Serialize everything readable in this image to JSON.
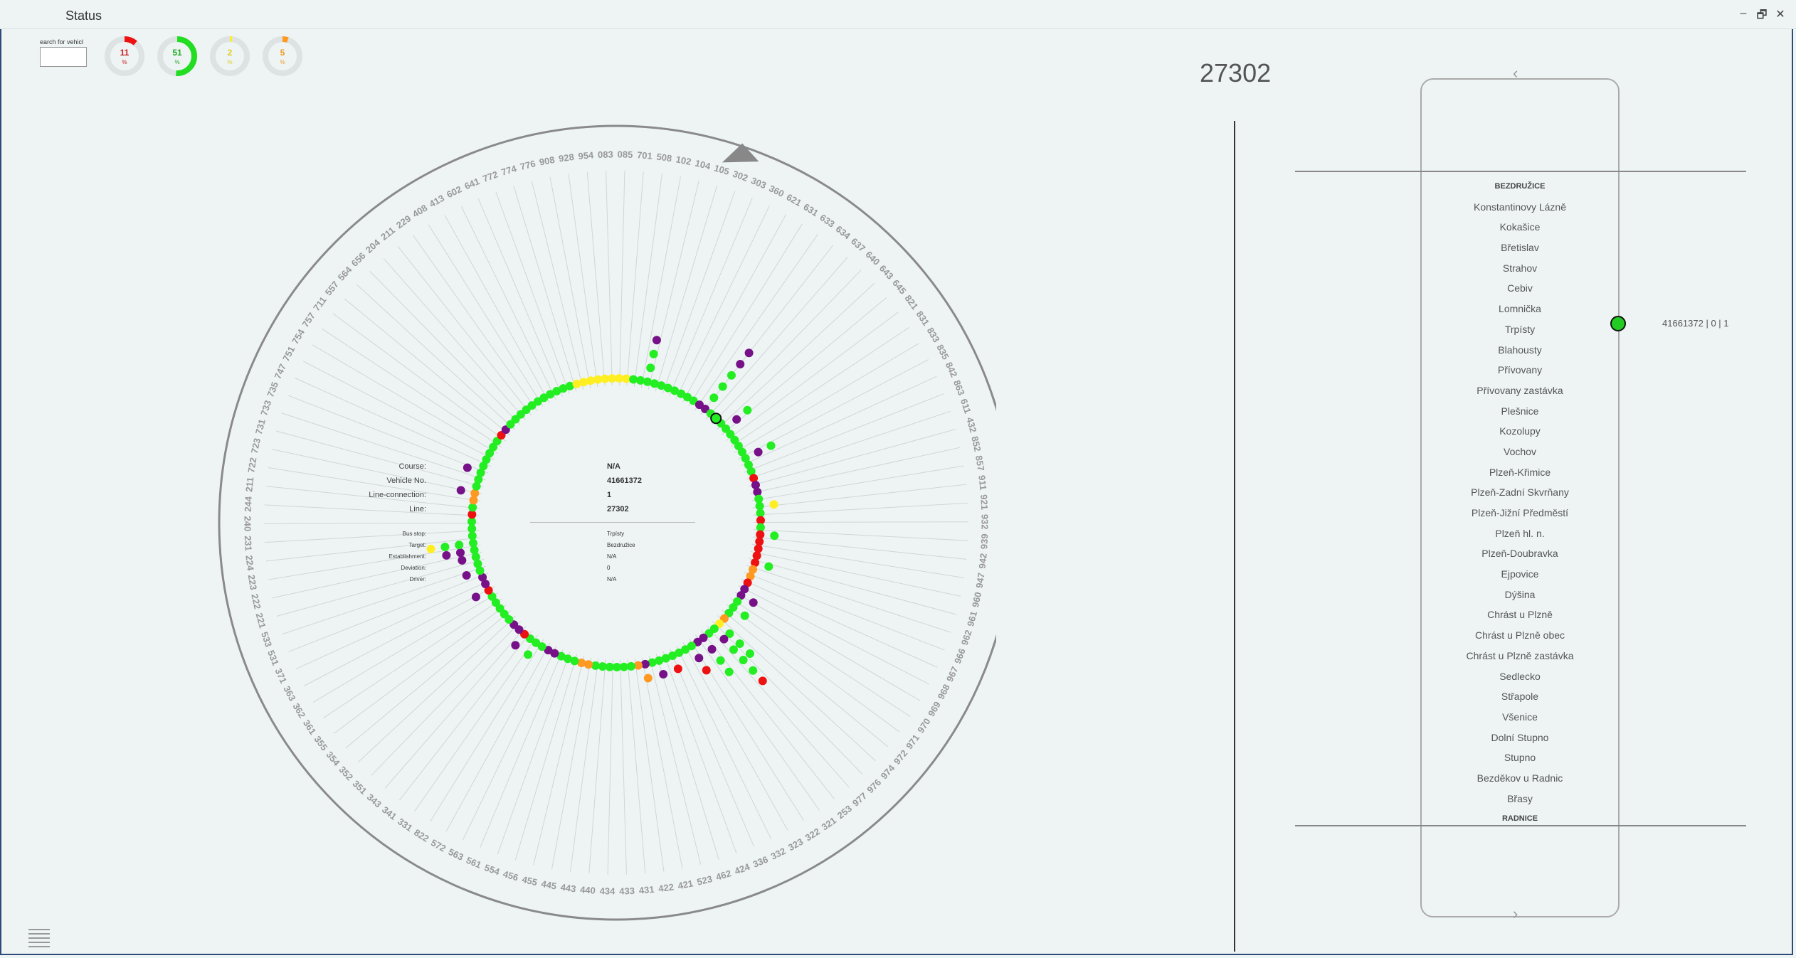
{
  "window": {
    "title": "Status",
    "controls": [
      "–",
      "🗗",
      "✕"
    ]
  },
  "search": {
    "label": "earch for vehicl",
    "value": ""
  },
  "gauges": [
    {
      "value": "11",
      "unit": "%",
      "fraction": 0.11,
      "color": "#ee1111",
      "text_color": "#cc2222"
    },
    {
      "value": "51",
      "unit": "%",
      "fraction": 0.51,
      "color": "#22dd22",
      "text_color": "#22aa22"
    },
    {
      "value": "2",
      "unit": "%",
      "fraction": 0.02,
      "color": "#ffee22",
      "text_color": "#ddcc22"
    },
    {
      "value": "5",
      "unit": "%",
      "fraction": 0.05,
      "color": "#ff9922",
      "text_color": "#ee9922"
    }
  ],
  "line_title": "27302",
  "radial": {
    "labels": [
      "083",
      "085",
      "701",
      "508",
      "102",
      "104",
      "105",
      "302",
      "303",
      "360",
      "621",
      "631",
      "633",
      "634",
      "637",
      "640",
      "643",
      "645",
      "821",
      "831",
      "833",
      "835",
      "842",
      "863",
      "611",
      "432",
      "852",
      "857",
      "911",
      "921",
      "932",
      "939",
      "942",
      "947",
      "960",
      "961",
      "962",
      "966",
      "967",
      "968",
      "969",
      "970",
      "971",
      "972",
      "974",
      "976",
      "977",
      "253",
      "321",
      "322",
      "323",
      "332",
      "336",
      "424",
      "462",
      "523",
      "421",
      "422",
      "431",
      "433",
      "434",
      "440",
      "443",
      "445",
      "455",
      "456",
      "554",
      "561",
      "563",
      "572",
      "822",
      "331",
      "341",
      "343",
      "351",
      "352",
      "354",
      "355",
      "361",
      "362",
      "363",
      "371",
      "531",
      "533",
      "221",
      "222",
      "223",
      "224",
      "231",
      "240",
      "244",
      "211",
      "722",
      "723",
      "731",
      "733",
      "735",
      "747",
      "751",
      "754",
      "757",
      "711",
      "557",
      "564",
      "656",
      "204",
      "211",
      "229",
      "408",
      "413",
      "602",
      "641",
      "772",
      "774",
      "776",
      "908",
      "928",
      "954"
    ],
    "start_angle": -1.6,
    "colors": {
      "green": "#22ee22",
      "yellow": "#ffee22",
      "red": "#ee1111",
      "purple": "#771188",
      "orange": "#ff9922"
    },
    "ring": "YYYGGGGGGGGGGPPGGGGGGGGGGGRPPGGGRGRRRRROORPPGGGOYGGPPGGGGGGGPOGGGGGGOOGGGPPGGGRPPGGGGGRPPGGGGGGGGRGOOGGGGGGGGRPGGGGGGGGGGGYYYYY",
    "outer": [
      {
        "i": 5,
        "d": 1,
        "c": "G"
      },
      {
        "i": 5,
        "d": 2,
        "c": "G"
      },
      {
        "i": 5,
        "d": 3,
        "c": "P"
      },
      {
        "i": 14,
        "d": 1,
        "c": "G"
      },
      {
        "i": 14,
        "d": 2,
        "c": "G"
      },
      {
        "i": 14,
        "d": 3,
        "c": "G"
      },
      {
        "i": 14,
        "d": 4,
        "c": "P"
      },
      {
        "i": 14,
        "d": 5,
        "c": "P"
      },
      {
        "i": 18,
        "d": 1,
        "c": "P"
      },
      {
        "i": 18,
        "d": 2,
        "c": "G"
      },
      {
        "i": 23,
        "d": 1,
        "c": "P"
      },
      {
        "i": 23,
        "d": 2,
        "c": "G"
      },
      {
        "i": 30,
        "d": 1,
        "c": "Y"
      },
      {
        "i": 34,
        "d": 1,
        "c": "G"
      },
      {
        "i": 38,
        "d": 1,
        "c": "G"
      },
      {
        "i": 43,
        "d": 1,
        "c": "P"
      },
      {
        "i": 45,
        "d": 1,
        "c": "G"
      },
      {
        "i": 48,
        "d": 1,
        "c": "G"
      },
      {
        "i": 48,
        "d": 2,
        "c": "G"
      },
      {
        "i": 48,
        "d": 3,
        "c": "G"
      },
      {
        "i": 49,
        "d": 1,
        "c": "P"
      },
      {
        "i": 49,
        "d": 2,
        "c": "G"
      },
      {
        "i": 49,
        "d": 3,
        "c": "G"
      },
      {
        "i": 49,
        "d": 4,
        "c": "G"
      },
      {
        "i": 49,
        "d": 5,
        "c": "R"
      },
      {
        "i": 51,
        "d": 1,
        "c": "P"
      },
      {
        "i": 51,
        "d": 2,
        "c": "G"
      },
      {
        "i": 51,
        "d": 3,
        "c": "G"
      },
      {
        "i": 53,
        "d": 1,
        "c": "P"
      },
      {
        "i": 53,
        "d": 2,
        "c": "R"
      },
      {
        "i": 56,
        "d": 1,
        "c": "R"
      },
      {
        "i": 58,
        "d": 1,
        "c": "P"
      },
      {
        "i": 60,
        "d": 1,
        "c": "O"
      },
      {
        "i": 76,
        "d": 1,
        "c": "G"
      },
      {
        "i": 78,
        "d": 1,
        "c": "P"
      },
      {
        "i": 86,
        "d": 1,
        "c": "P"
      },
      {
        "i": 89,
        "d": 1,
        "c": "P"
      },
      {
        "i": 91,
        "d": 1,
        "c": "P"
      },
      {
        "i": 92,
        "d": 1,
        "c": "P"
      },
      {
        "i": 92,
        "d": 2,
        "c": "P"
      },
      {
        "i": 93,
        "d": 1,
        "c": "G"
      },
      {
        "i": 93,
        "d": 2,
        "c": "G"
      },
      {
        "i": 93,
        "d": 3,
        "c": "Y"
      },
      {
        "i": 100,
        "d": 1,
        "c": "P"
      },
      {
        "i": 103,
        "d": 1,
        "c": "P"
      }
    ]
  },
  "vehicle_info": {
    "rows": [
      {
        "key": "Course:",
        "value": "N/A"
      },
      {
        "key": "Vehicle No.",
        "value": "41661372"
      },
      {
        "key": "Line-connection:",
        "value": "1"
      },
      {
        "key": "Line:",
        "value": "27302"
      }
    ],
    "small_rows": [
      {
        "key": "Bus stop:",
        "value": "Trpísty"
      },
      {
        "key": "Target:",
        "value": "Bezdružice"
      },
      {
        "key": "Establishment:",
        "value": "N/A"
      },
      {
        "key": "Deviation:",
        "value": "0"
      },
      {
        "key": "Driver:",
        "value": "N/A"
      }
    ]
  },
  "route": {
    "arrow_up": "‹",
    "arrow_down": "›",
    "stops": [
      "BEZDRUŽICE",
      "Konstantinovy Lázně",
      "Kokašice",
      "Břetislav",
      "Strahov",
      "Cebiv",
      "Lomnička",
      "Trpísty",
      "Blahousty",
      "Přívovany",
      "Přívovany zastávka",
      "Plešnice",
      "Kozolupy",
      "Vochov",
      "Plzeň-Křimice",
      "Plzeň-Zadní Skvrňany",
      "Plzeň-Jižní Předměstí",
      "Plzeň hl. n.",
      "Plzeň-Doubravka",
      "Ejpovice",
      "Dýšina",
      "Chrást u Plzně",
      "Chrást u Plzně obec",
      "Chrást u Plzně zastávka",
      "Sedlecko",
      "Střapole",
      "Všenice",
      "Dolní Stupno",
      "Stupno",
      "Bezděkov u Radnic",
      "Břasy",
      "RADNICE"
    ],
    "vehicle_label": "41661372 | 0 | 1"
  }
}
